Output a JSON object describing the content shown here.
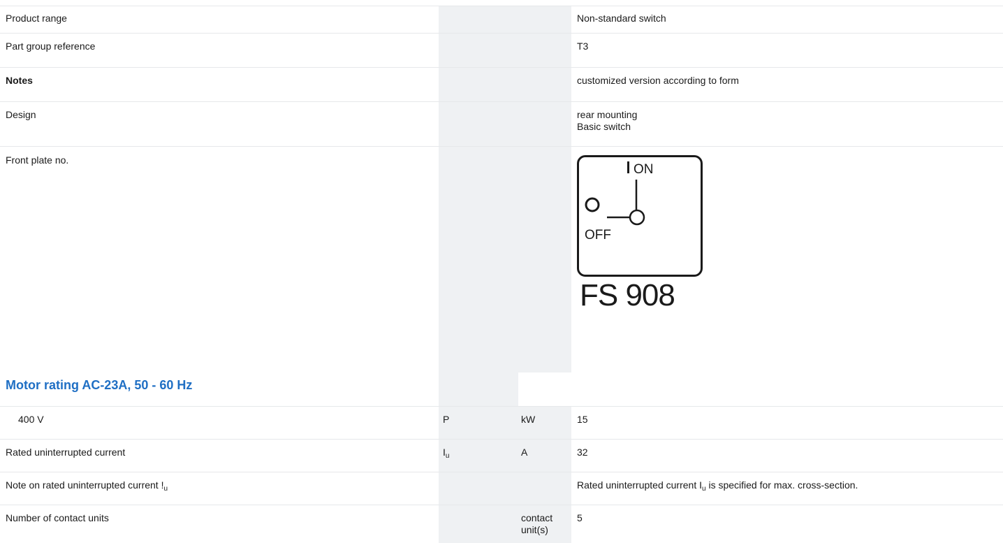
{
  "rows": {
    "product_range": {
      "label": "Product range",
      "value": "Non-standard switch"
    },
    "part_group": {
      "label": "Part group reference",
      "value": "T3"
    },
    "notes": {
      "label": "Notes",
      "value": "customized version according to form"
    },
    "design": {
      "label": "Design",
      "value_line1": "rear mounting",
      "value_line2": "Basic switch"
    },
    "front_plate": {
      "label": "Front plate no.",
      "on_text": "ON",
      "off_text": "OFF",
      "code": "FS 908"
    }
  },
  "section": {
    "title": "Motor rating AC-23A, 50 - 60 Hz"
  },
  "rows2": {
    "v400": {
      "label": "400 V",
      "symbol": "P",
      "unit": "kW",
      "value": "15"
    },
    "rated_current": {
      "label": "Rated uninterrupted current",
      "symbol": "I",
      "symbol_sub": "u",
      "unit": "A",
      "value": "32"
    },
    "note_current": {
      "label": "Note on rated uninterrupted current !",
      "label_sub": "u",
      "value_pre": "Rated uninterrupted current I",
      "value_sub": "u",
      "value_post": " is specified for max. cross-section."
    },
    "contact_units": {
      "label": "Number of contact units",
      "unit_line1": "contact",
      "unit_line2": "unit(s)",
      "value": "5"
    }
  }
}
